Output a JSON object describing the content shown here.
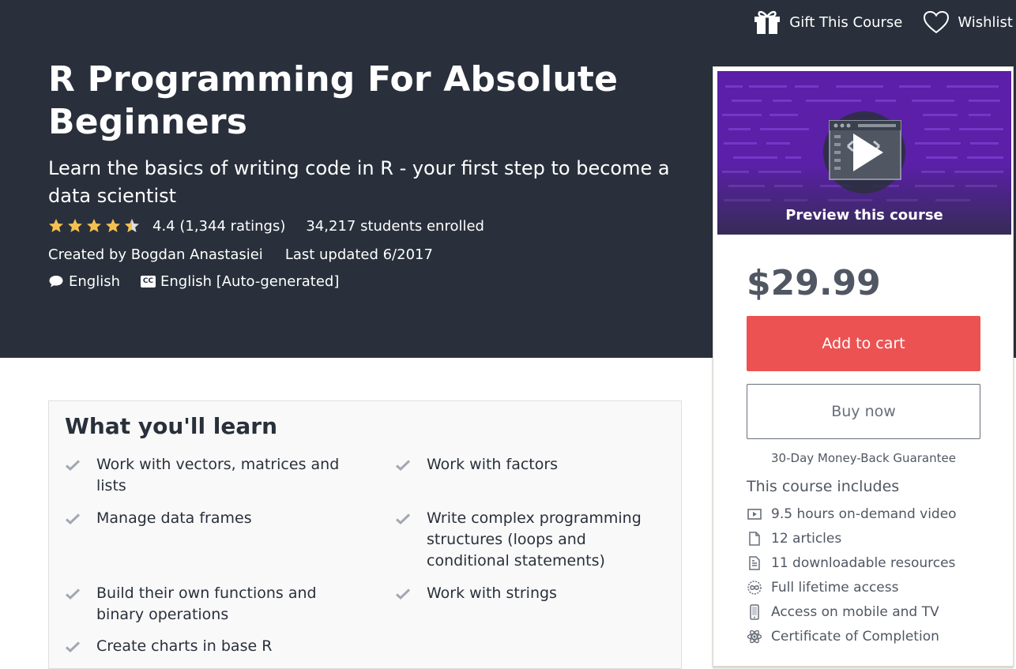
{
  "topbar": {
    "gift_label": "Gift This Course",
    "wishlist_label": "Wishlist"
  },
  "course": {
    "title": "R Programming For Absolute Beginners",
    "subtitle": "Learn the basics of writing code in R - your first step to become a data scientist",
    "rating_value": 4.4,
    "rating_text": "4.4 (1,344 ratings)",
    "enrolled": "34,217 students enrolled",
    "created_by": "Created by Bogdan Anastasiei",
    "last_updated": "Last updated 6/2017",
    "language": "English",
    "caption_badge": "CC",
    "captions": "English [Auto-generated]"
  },
  "sidebar": {
    "preview_label": "Preview this course",
    "price": "$29.99",
    "add_to_cart": "Add to cart",
    "buy_now": "Buy now",
    "guarantee": "30-Day Money-Back Guarantee",
    "includes_title": "This course includes",
    "includes": [
      {
        "icon": "video-icon",
        "label": "9.5 hours on-demand video"
      },
      {
        "icon": "article-icon",
        "label": "12 articles"
      },
      {
        "icon": "download-file-icon",
        "label": "11 downloadable resources"
      },
      {
        "icon": "infinity-icon",
        "label": "Full lifetime access"
      },
      {
        "icon": "mobile-icon",
        "label": "Access on mobile and TV"
      },
      {
        "icon": "certificate-icon",
        "label": "Certificate of Completion"
      }
    ]
  },
  "learn": {
    "title": "What you'll learn",
    "items": [
      "Work with vectors, matrices and lists",
      "Work with factors",
      "Manage data frames",
      "Write complex programming structures (loops and conditional statements)",
      "Build their own functions and binary operations",
      "Work with strings",
      "Create charts in base R"
    ]
  },
  "colors": {
    "hero_bg": "#29303b",
    "accent_red": "#ec5252",
    "star": "#f4c150",
    "preview_purple": "#5b1fa8"
  }
}
